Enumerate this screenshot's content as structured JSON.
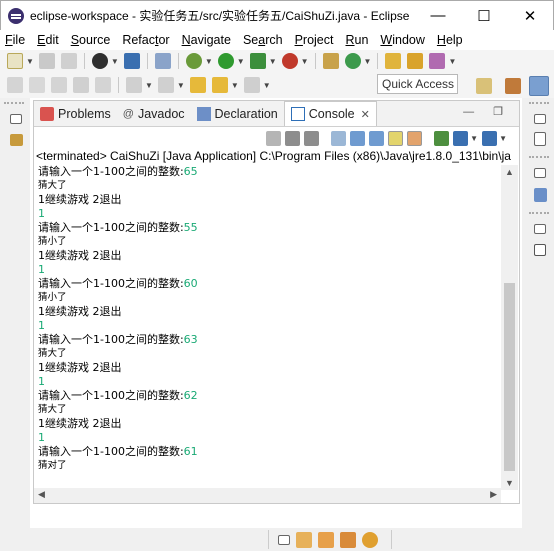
{
  "window": {
    "title": "eclipse-workspace - 实验任务五/src/实验任务五/CaiShuZi.java - Eclipse",
    "minimize": "—",
    "maximize": "☐",
    "close": "✕"
  },
  "menu": [
    {
      "acc": "F",
      "rest": "ile"
    },
    {
      "acc": "E",
      "rest": "dit"
    },
    {
      "acc": "S",
      "rest": "ource"
    },
    {
      "pre": "Refac",
      "acc": "t",
      "rest": "or"
    },
    {
      "acc": "N",
      "rest": "avigate"
    },
    {
      "pre": "Se",
      "acc": "a",
      "rest": "rch"
    },
    {
      "acc": "P",
      "rest": "roject"
    },
    {
      "acc": "R",
      "rest": "un"
    },
    {
      "acc": "W",
      "rest": "indow"
    },
    {
      "acc": "H",
      "rest": "elp"
    }
  ],
  "quick_access": "Quick Access",
  "tabs": {
    "problems": "Problems",
    "javadoc": "Javadoc",
    "declaration": "Declaration",
    "console": "Console"
  },
  "console": {
    "terminated": "<terminated> CaiShuZi [Java Application] C:\\Program Files (x86)\\Java\\jre1.8.0_131\\bin\\ja",
    "lines": [
      {
        "text": "请输入一个1-100之间的整数:",
        "num": "65",
        "big": true
      },
      {
        "text": "猜大了"
      },
      {
        "text": "1继续游戏 2退出",
        "big": true
      },
      {
        "text": "",
        "num": "1"
      },
      {
        "text": "请输入一个1-100之间的整数:",
        "num": "55",
        "big": true
      },
      {
        "text": "猜小了"
      },
      {
        "text": "1继续游戏 2退出",
        "big": true
      },
      {
        "text": "",
        "num": "1"
      },
      {
        "text": "请输入一个1-100之间的整数:",
        "num": "60",
        "big": true
      },
      {
        "text": "猜小了"
      },
      {
        "text": "1继续游戏 2退出",
        "big": true
      },
      {
        "text": "",
        "num": "1"
      },
      {
        "text": "请输入一个1-100之间的整数:",
        "num": "63",
        "big": true
      },
      {
        "text": "猜大了"
      },
      {
        "text": "1继续游戏 2退出",
        "big": true
      },
      {
        "text": "",
        "num": "1"
      },
      {
        "text": "请输入一个1-100之间的整数:",
        "num": "62",
        "big": true
      },
      {
        "text": "猜大了"
      },
      {
        "text": "1继续游戏 2退出",
        "big": true
      },
      {
        "text": "",
        "num": "1"
      },
      {
        "text": "请输入一个1-100之间的整数:",
        "num": "61",
        "big": true
      },
      {
        "text": "猜对了"
      }
    ]
  },
  "colors": {
    "input_number": "#19a974",
    "accent": "#2e6fb7"
  }
}
